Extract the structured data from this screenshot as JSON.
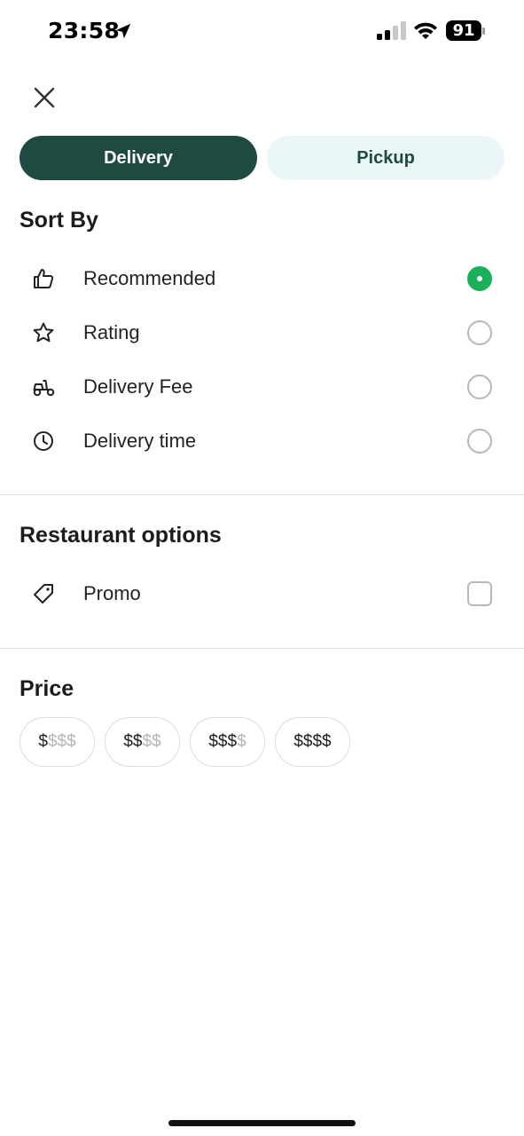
{
  "status_bar": {
    "time": "23:58",
    "battery": "91"
  },
  "mode_toggle": {
    "delivery_label": "Delivery",
    "pickup_label": "Pickup",
    "selected": "Delivery"
  },
  "sort_by": {
    "title": "Sort By",
    "options": [
      {
        "label": "Recommended",
        "icon": "thumbs-up-icon",
        "selected": true
      },
      {
        "label": "Rating",
        "icon": "star-icon",
        "selected": false
      },
      {
        "label": "Delivery Fee",
        "icon": "scooter-icon",
        "selected": false
      },
      {
        "label": "Delivery time",
        "icon": "clock-icon",
        "selected": false
      }
    ]
  },
  "restaurant_options": {
    "title": "Restaurant options",
    "options": [
      {
        "label": "Promo",
        "icon": "tag-icon",
        "checked": false
      }
    ]
  },
  "price": {
    "title": "Price",
    "chips": [
      {
        "on": "$",
        "off": "$$$"
      },
      {
        "on": "$$",
        "off": "$$"
      },
      {
        "on": "$$$",
        "off": "$"
      },
      {
        "on": "$$$$",
        "off": ""
      }
    ]
  },
  "colors": {
    "primary": "#1e4a42",
    "toggle_inactive_bg": "#eaf6f7",
    "radio_selected": "#1bb05a",
    "muted_text": "#b5b5b5"
  }
}
